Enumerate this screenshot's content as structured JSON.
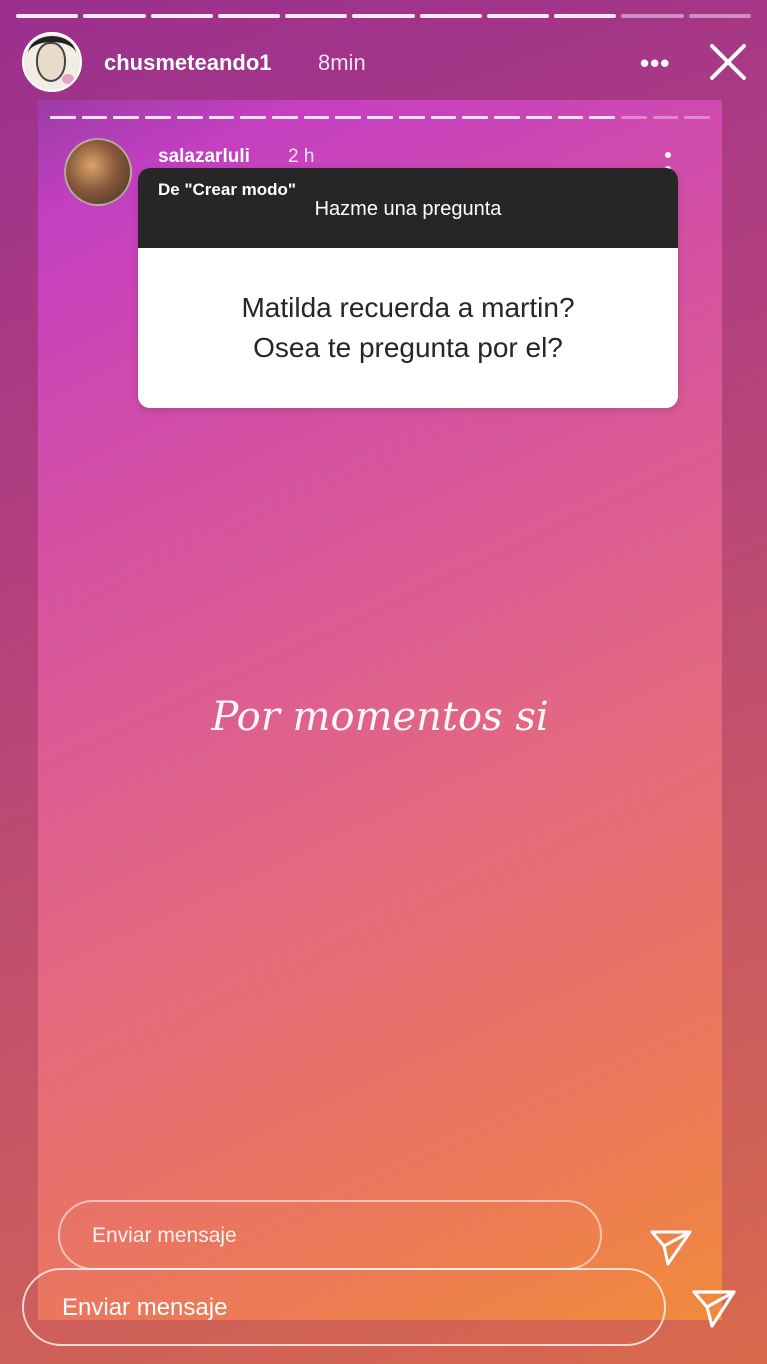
{
  "outer": {
    "progress": {
      "total": 11,
      "viewed": 9
    },
    "header": {
      "username": "chusmeteando1",
      "timeago": "8min",
      "more_icon": "more-horizontal-icon",
      "close_icon": "close-icon"
    },
    "message_placeholder": "Enviar mensaje",
    "send_icon": "send-icon"
  },
  "story": {
    "progress": {
      "total": 21,
      "viewed": 18
    },
    "username": "salazarluli",
    "timeago": "2 h",
    "question_card": {
      "from_label": "De \"Crear modo\"",
      "prompt": "Hazme una pregunta",
      "question_line1": "Matilda recuerda a martin?",
      "question_line2": "Osea te pregunta por el?"
    },
    "answer": "Por momentos si",
    "message_placeholder": "Enviar mensaje"
  }
}
